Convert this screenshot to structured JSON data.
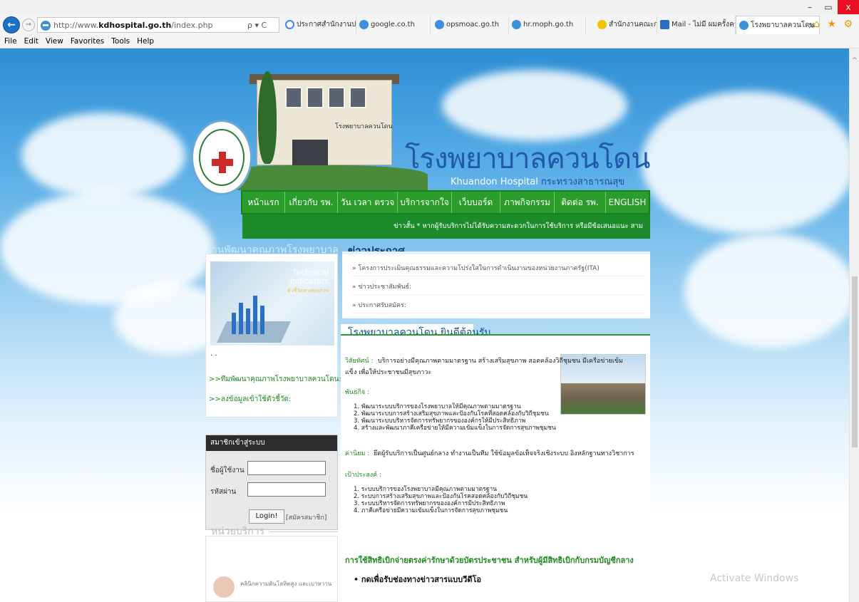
{
  "browser": {
    "url_prefix": "http://www.",
    "url_domain": "kdhospital.go.th",
    "url_path": "/index.php",
    "search_glyphs": "ρ ▾ C",
    "tabs": [
      "ประกาศสำนักงานปลัดกระทรว...",
      "google.co.th",
      "opsmoac.go.th",
      "hr.moph.go.th",
      "สำนักงานคณะกรรมการข้าราช...",
      "Mail - ไม่มี ผมครั้งครัว - Ou...",
      "โรงพยาบาลควนโดน"
    ],
    "tab_close": "×",
    "window_controls": [
      "–",
      "▭",
      "x"
    ],
    "toolbar_icons": "⌂ ★ ⚙",
    "menu": [
      "File",
      "Edit",
      "View",
      "Favorites",
      "Tools",
      "Help"
    ]
  },
  "header": {
    "building_sign": "โรงพยาบาลควนโดน",
    "title": "โรงพยาบาลควนโดน",
    "subtitle": "Khuandon Hospital",
    "ministry": "กระทรวงสาธารณสุข"
  },
  "nav": [
    "หน้าแรก",
    "เกี่ยวกับ รพ.",
    "วัน เวลา ตรวจ",
    "บริการจากใจ",
    "เว็บบอร์ด",
    "ภาพกิจกรรม",
    "ติดต่อ รพ.",
    "ENGLISH"
  ],
  "ticker": "ข่าวสั้น * หากผู้รับบริการไม่ได้รับความสะดวกในการใช้บริการ หรือมีข้อเสนอแนะ สาม",
  "quality": {
    "heading": "งานพัฒนาคุณภาพโรงพยาบาล",
    "image_title": "Technical\nindicators",
    "image_sub": "ตัวชี้วัดทางคุณภาพ",
    "dots": ". .",
    "link1": ">>ทีมพัฒนาคุณภาพโรงพยาบาลควนโดน:",
    "link2": ">>ลงข้อมูลเข้าใช้ตัวชี้วัด:"
  },
  "login": {
    "heading": "สมาชิกเข้าสู่ระบบ",
    "username_label": "ชื่อผู้ใช้งาน",
    "password_label": "รหัสผ่าน",
    "button": "Login!",
    "register": "[สมัครสมาชิก]"
  },
  "services": {
    "heading": "หน่วยบริการ",
    "item": "คลินิกความดันโลหิตสูง และเบาหวาน"
  },
  "news": {
    "heading": "ข่าวประกาศ",
    "items": [
      "» โครงการประเมินคุณธรรมและความโปร่งใสในการดำเนินงานของหน่วยงานภาครัฐ(ITA)",
      "» ข่าวประชาสัมพันธ์:",
      "» ประกาศรับสมัคร:"
    ]
  },
  "welcome": {
    "heading": "โรงพยาบาลควนโดน ยินดีต้อนรับ",
    "vision_label": "วิสัยทัศน์ :",
    "vision_text": "บริการอย่างมีคุณภาพตามมาตรฐาน สร้างเสริมสุขภาพ สอดคล้องวิถีชุมชน มีเครือข่ายเข้ม",
    "vision_text2": "แข็ง เพื่อให้ประชาชนมีสุขภาวะ",
    "mission_label": "พันธกิจ :",
    "missions": [
      "1.  พัฒนาระบบบริการของโรงพยาบาลให้มีคุณภาพตามมาตรฐาน",
      "2.  พัฒนาระบบการสร้างเสริมสุขภาพและป้องกันโรคที่สอดคล้องกับวิถีชุมชน",
      "3.  พัฒนาระบบบริหารจัดการทรัพยากรขององค์กรให้มีประสิทธิภาพ",
      "4.  สร้างและพัฒนาภาคีเครือข่ายให้มีความเข้มแข็งในการจัดการสุขภาพชุมชน"
    ],
    "value_label": "ค่านิยม :",
    "value_text": "ยึดผู้รับบริการเป็นศูนย์กลาง ทำงานเป็นทีม ใช้ข้อมูลข้อเท็จจริงเชิงระบบ อิงหลักฐานทางวิชาการ",
    "goal_label": "เป้าประสงค์ :",
    "goals": [
      "1.  ระบบบริการของโรงพยาบาลมีคุณภาพตามมาตรฐาน",
      "2.  ระบบการสร้างเสริมสุขภาพและป้องกันโรคสอดคล้องกับวิถีชุมชน",
      "3.  ระบบบริหารจัดการทรัพยากรขององค์การมีประสิทธิภาพ",
      "4.  ภาคีเครือข่ายมีความเข้มแข็งในการจัดการสุขภาพชุมชน"
    ],
    "rights_heading": "การใช้สิทธิเบิกจ่ายตรงค่ารักษาด้วยบัตรประชาชน สำหรับผู้มีสิทธิเบิกกับกรมบัญชีกลาง",
    "video_link": "•  กดเพื่อรับช่องทางข่าวสารแบบวีดีโอ"
  },
  "watermark": "Activate Windows",
  "colors": {
    "nav_green": "#2a9d2a",
    "title_blue": "#1e5aa8",
    "link_green": "#1f8a1f"
  }
}
